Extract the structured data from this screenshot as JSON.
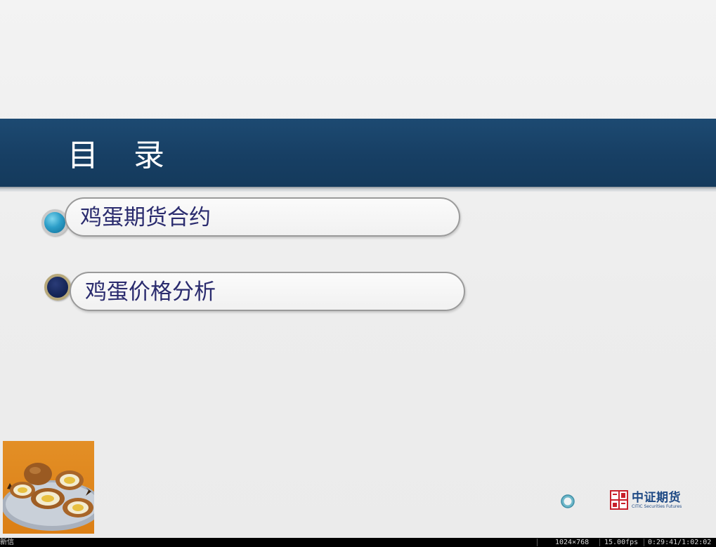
{
  "slide": {
    "title": "目 录",
    "items": [
      {
        "label": "鸡蛋期货合约",
        "bullet_color": "#2c9ec8"
      },
      {
        "label": "鸡蛋价格分析",
        "bullet_color": "#152557"
      }
    ],
    "band_color": "#173f64",
    "photo_icon": "braised-eggs-photo",
    "nav_icon": "circle-nav-icon"
  },
  "logo": {
    "name_cn": "中证期货",
    "name_en": "CITIC Securities Futures",
    "seal_text": "中信証券"
  },
  "statusbar": {
    "left_text": "新信",
    "resolution": "1024×768",
    "fps": "15.00fps",
    "time": "0:29:41/1:02:02"
  }
}
